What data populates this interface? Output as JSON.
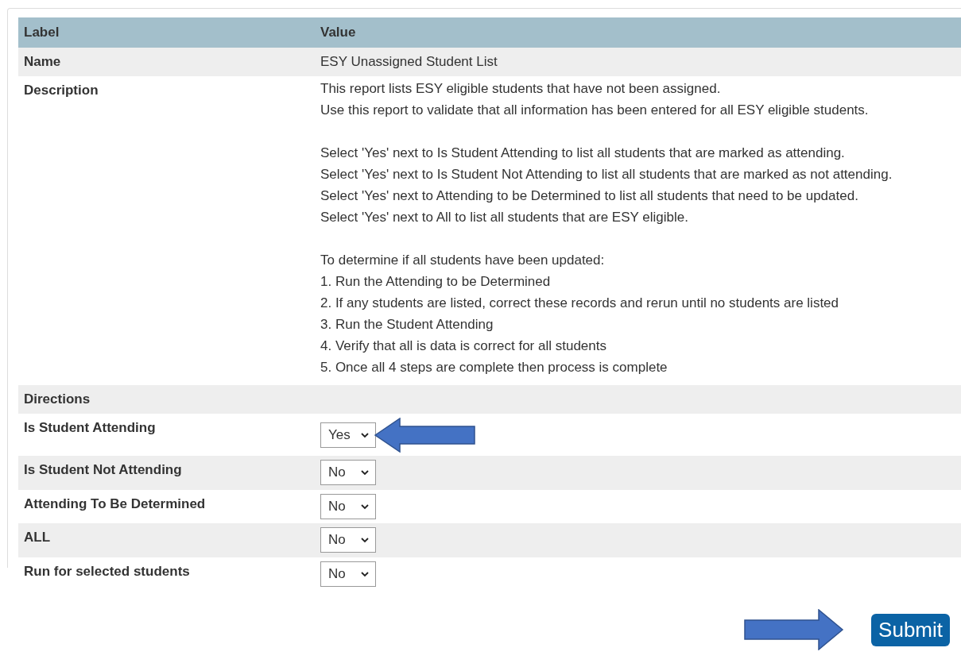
{
  "table": {
    "columns": [
      "Label",
      "Value"
    ],
    "name": {
      "label": "Name",
      "value": "ESY Unassigned Student List"
    },
    "description": {
      "label": "Description",
      "paragraphs": [
        [
          "This report lists ESY eligible students that have not been assigned.",
          "Use this report to validate that all information has been entered for all ESY eligible students."
        ],
        [
          "Select 'Yes' next to Is Student Attending to list all students that are marked as attending.",
          "Select 'Yes' next to Is Student Not Attending to list all students that are marked as not attending.",
          "Select 'Yes' next to Attending to be Determined to list all students that need to be updated.",
          "Select 'Yes' next to All to list all students that are ESY eligible."
        ],
        [
          "To determine if all students have been updated:",
          "1. Run the Attending to be Determined",
          "2. If any students are listed, correct these records and rerun until no students are listed",
          "3. Run the Student Attending",
          "4. Verify that all is data is correct for all students",
          "5. Once all 4 steps are complete then process is complete"
        ]
      ]
    },
    "section": {
      "label": "Directions"
    },
    "parameters": [
      {
        "label": "Is Student Attending",
        "value": "Yes",
        "arrow": true
      },
      {
        "label": "Is Student Not Attending",
        "value": "No",
        "arrow": false
      },
      {
        "label": "Attending To Be Determined",
        "value": "No",
        "arrow": false
      },
      {
        "label": "ALL",
        "value": "No",
        "arrow": false
      },
      {
        "label": "Run for selected students",
        "value": "No",
        "arrow": false
      }
    ]
  },
  "submit": {
    "label": "Submit",
    "arrow": true
  }
}
